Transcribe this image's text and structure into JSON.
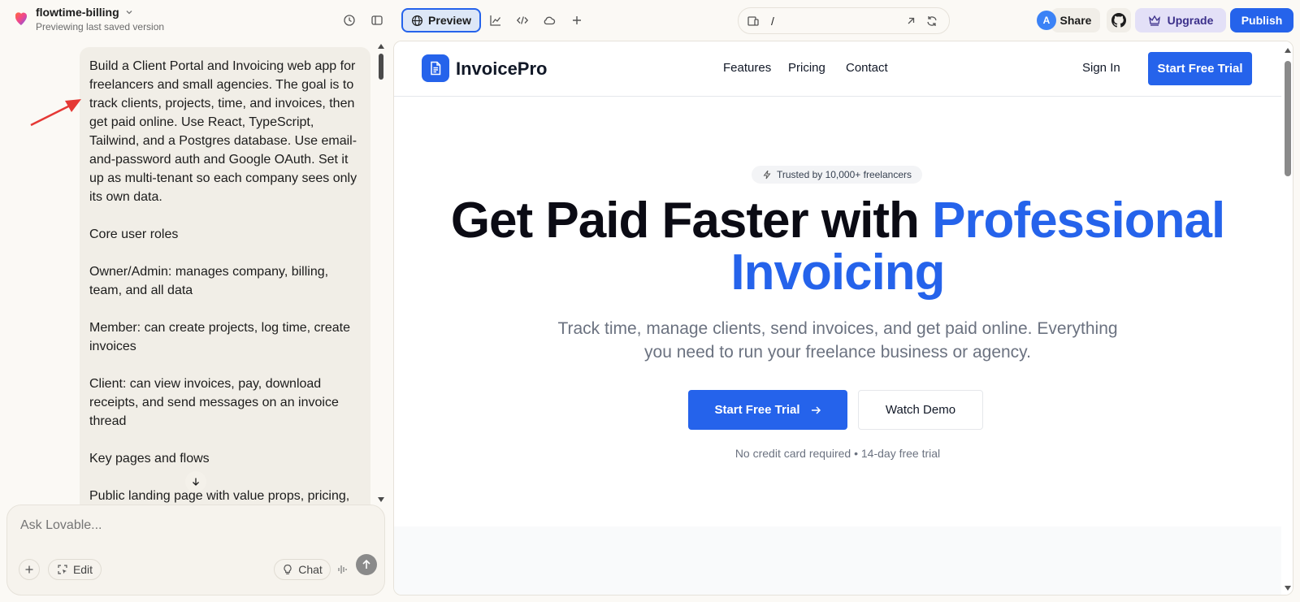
{
  "app": {
    "project_name": "flowtime-billing",
    "project_status": "Previewing last saved version"
  },
  "toolbar": {
    "preview_label": "Preview",
    "url_path": "/",
    "avatar_initial": "A",
    "share_label": "Share",
    "upgrade_label": "Upgrade",
    "publish_label": "Publish",
    "accent_color": "#2563eb"
  },
  "chat": {
    "message_paragraphs": [
      "Build a Client Portal and Invoicing web app for freelancers and small agencies. The goal is to track clients, projects, time, and invoices, then get paid online. Use React, TypeScript, Tailwind, and a Postgres database. Use email-and-password auth and Google OAuth. Set it up as multi-tenant so each company sees only its own data.",
      "Core user roles",
      "Owner/Admin: manages company, billing, team, and all data",
      "Member: can create projects, log time, create invoices",
      "Client: can view invoices, pay, download receipts, and send messages on an invoice thread",
      "Key pages and flows",
      "Public landing page with value props, pricing,"
    ],
    "composer_placeholder": "Ask Lovable...",
    "edit_label": "Edit",
    "chat_label": "Chat"
  },
  "site": {
    "brand": "InvoicePro",
    "nav": [
      "Features",
      "Pricing",
      "Contact"
    ],
    "sign_in": "Sign In",
    "nav_cta": "Start Free Trial",
    "trust_badge": "Trusted by 10,000+ freelancers",
    "hero_title_main": "Get Paid Faster with ",
    "hero_title_accent": "Professional Invoicing",
    "hero_subtitle": "Track time, manage clients, send invoices, and get paid online. Everything you need to run your freelance business or agency.",
    "cta_primary": "Start Free Trial",
    "cta_secondary": "Watch Demo",
    "fine_print": "No credit card required • 14-day free trial"
  }
}
